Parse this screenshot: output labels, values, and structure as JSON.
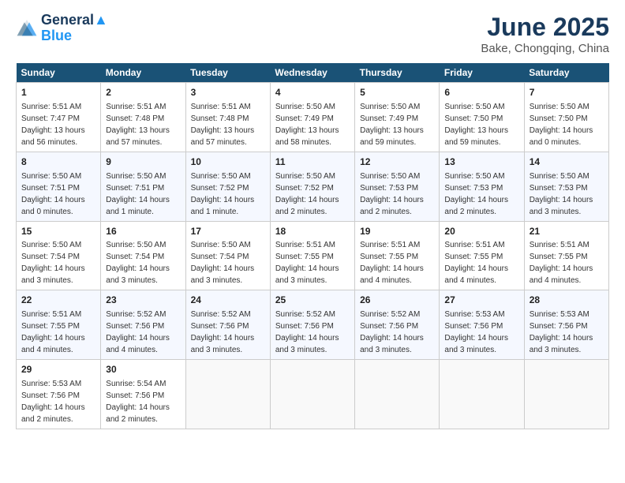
{
  "logo": {
    "line1": "General",
    "line2": "Blue"
  },
  "title": "June 2025",
  "subtitle": "Bake, Chongqing, China",
  "days_of_week": [
    "Sunday",
    "Monday",
    "Tuesday",
    "Wednesday",
    "Thursday",
    "Friday",
    "Saturday"
  ],
  "weeks": [
    [
      {
        "day": "1",
        "sunrise": "5:51 AM",
        "sunset": "7:47 PM",
        "daylight": "13 hours and 56 minutes."
      },
      {
        "day": "2",
        "sunrise": "5:51 AM",
        "sunset": "7:48 PM",
        "daylight": "13 hours and 57 minutes."
      },
      {
        "day": "3",
        "sunrise": "5:51 AM",
        "sunset": "7:48 PM",
        "daylight": "13 hours and 57 minutes."
      },
      {
        "day": "4",
        "sunrise": "5:50 AM",
        "sunset": "7:49 PM",
        "daylight": "13 hours and 58 minutes."
      },
      {
        "day": "5",
        "sunrise": "5:50 AM",
        "sunset": "7:49 PM",
        "daylight": "13 hours and 59 minutes."
      },
      {
        "day": "6",
        "sunrise": "5:50 AM",
        "sunset": "7:50 PM",
        "daylight": "13 hours and 59 minutes."
      },
      {
        "day": "7",
        "sunrise": "5:50 AM",
        "sunset": "7:50 PM",
        "daylight": "14 hours and 0 minutes."
      }
    ],
    [
      {
        "day": "8",
        "sunrise": "5:50 AM",
        "sunset": "7:51 PM",
        "daylight": "14 hours and 0 minutes."
      },
      {
        "day": "9",
        "sunrise": "5:50 AM",
        "sunset": "7:51 PM",
        "daylight": "14 hours and 1 minute."
      },
      {
        "day": "10",
        "sunrise": "5:50 AM",
        "sunset": "7:52 PM",
        "daylight": "14 hours and 1 minute."
      },
      {
        "day": "11",
        "sunrise": "5:50 AM",
        "sunset": "7:52 PM",
        "daylight": "14 hours and 2 minutes."
      },
      {
        "day": "12",
        "sunrise": "5:50 AM",
        "sunset": "7:53 PM",
        "daylight": "14 hours and 2 minutes."
      },
      {
        "day": "13",
        "sunrise": "5:50 AM",
        "sunset": "7:53 PM",
        "daylight": "14 hours and 2 minutes."
      },
      {
        "day": "14",
        "sunrise": "5:50 AM",
        "sunset": "7:53 PM",
        "daylight": "14 hours and 3 minutes."
      }
    ],
    [
      {
        "day": "15",
        "sunrise": "5:50 AM",
        "sunset": "7:54 PM",
        "daylight": "14 hours and 3 minutes."
      },
      {
        "day": "16",
        "sunrise": "5:50 AM",
        "sunset": "7:54 PM",
        "daylight": "14 hours and 3 minutes."
      },
      {
        "day": "17",
        "sunrise": "5:50 AM",
        "sunset": "7:54 PM",
        "daylight": "14 hours and 3 minutes."
      },
      {
        "day": "18",
        "sunrise": "5:51 AM",
        "sunset": "7:55 PM",
        "daylight": "14 hours and 3 minutes."
      },
      {
        "day": "19",
        "sunrise": "5:51 AM",
        "sunset": "7:55 PM",
        "daylight": "14 hours and 4 minutes."
      },
      {
        "day": "20",
        "sunrise": "5:51 AM",
        "sunset": "7:55 PM",
        "daylight": "14 hours and 4 minutes."
      },
      {
        "day": "21",
        "sunrise": "5:51 AM",
        "sunset": "7:55 PM",
        "daylight": "14 hours and 4 minutes."
      }
    ],
    [
      {
        "day": "22",
        "sunrise": "5:51 AM",
        "sunset": "7:55 PM",
        "daylight": "14 hours and 4 minutes."
      },
      {
        "day": "23",
        "sunrise": "5:52 AM",
        "sunset": "7:56 PM",
        "daylight": "14 hours and 4 minutes."
      },
      {
        "day": "24",
        "sunrise": "5:52 AM",
        "sunset": "7:56 PM",
        "daylight": "14 hours and 3 minutes."
      },
      {
        "day": "25",
        "sunrise": "5:52 AM",
        "sunset": "7:56 PM",
        "daylight": "14 hours and 3 minutes."
      },
      {
        "day": "26",
        "sunrise": "5:52 AM",
        "sunset": "7:56 PM",
        "daylight": "14 hours and 3 minutes."
      },
      {
        "day": "27",
        "sunrise": "5:53 AM",
        "sunset": "7:56 PM",
        "daylight": "14 hours and 3 minutes."
      },
      {
        "day": "28",
        "sunrise": "5:53 AM",
        "sunset": "7:56 PM",
        "daylight": "14 hours and 3 minutes."
      }
    ],
    [
      {
        "day": "29",
        "sunrise": "5:53 AM",
        "sunset": "7:56 PM",
        "daylight": "14 hours and 2 minutes."
      },
      {
        "day": "30",
        "sunrise": "5:54 AM",
        "sunset": "7:56 PM",
        "daylight": "14 hours and 2 minutes."
      },
      null,
      null,
      null,
      null,
      null
    ]
  ],
  "labels": {
    "sunrise": "Sunrise:",
    "sunset": "Sunset:",
    "daylight": "Daylight:"
  }
}
